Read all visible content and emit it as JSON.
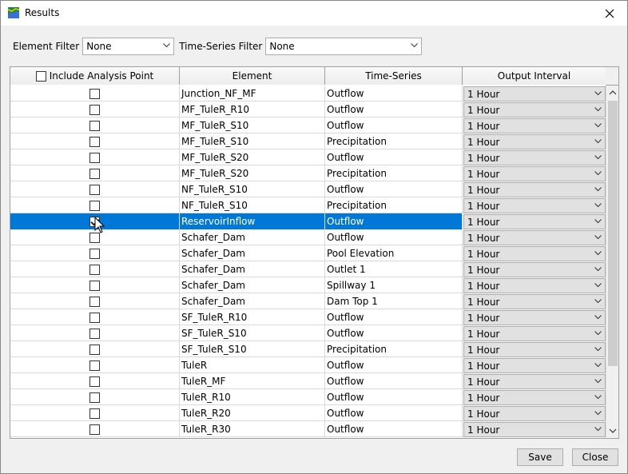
{
  "window": {
    "title": "Results"
  },
  "filters": {
    "element_label": "Element Filter",
    "element_value": "None",
    "timeseries_label": "Time-Series Filter",
    "timeseries_value": "None"
  },
  "table": {
    "headers": {
      "include": "Include Analysis Point",
      "element": "Element",
      "timeseries": "Time-Series",
      "interval": "Output Interval"
    },
    "rows": [
      {
        "checked": false,
        "element": "Junction_NF_MF",
        "timeseries": "Outflow",
        "interval": "1 Hour"
      },
      {
        "checked": false,
        "element": "MF_TuleR_R10",
        "timeseries": "Outflow",
        "interval": "1 Hour"
      },
      {
        "checked": false,
        "element": "MF_TuleR_S10",
        "timeseries": "Outflow",
        "interval": "1 Hour"
      },
      {
        "checked": false,
        "element": "MF_TuleR_S10",
        "timeseries": "Precipitation",
        "interval": "1 Hour"
      },
      {
        "checked": false,
        "element": "MF_TuleR_S20",
        "timeseries": "Outflow",
        "interval": "1 Hour"
      },
      {
        "checked": false,
        "element": "MF_TuleR_S20",
        "timeseries": "Precipitation",
        "interval": "1 Hour"
      },
      {
        "checked": false,
        "element": "NF_TuleR_S10",
        "timeseries": "Outflow",
        "interval": "1 Hour"
      },
      {
        "checked": false,
        "element": "NF_TuleR_S10",
        "timeseries": "Precipitation",
        "interval": "1 Hour"
      },
      {
        "checked": true,
        "selected": true,
        "element": "ReservoirInflow",
        "timeseries": "Outflow",
        "interval": "1 Hour"
      },
      {
        "checked": false,
        "element": "Schafer_Dam",
        "timeseries": "Outflow",
        "interval": "1 Hour"
      },
      {
        "checked": false,
        "element": "Schafer_Dam",
        "timeseries": "Pool Elevation",
        "interval": "1 Hour"
      },
      {
        "checked": false,
        "element": "Schafer_Dam",
        "timeseries": "Outlet 1",
        "interval": "1 Hour"
      },
      {
        "checked": false,
        "element": "Schafer_Dam",
        "timeseries": "Spillway 1",
        "interval": "1 Hour"
      },
      {
        "checked": false,
        "element": "Schafer_Dam",
        "timeseries": "Dam Top 1",
        "interval": "1 Hour"
      },
      {
        "checked": false,
        "element": "SF_TuleR_R10",
        "timeseries": "Outflow",
        "interval": "1 Hour"
      },
      {
        "checked": false,
        "element": "SF_TuleR_S10",
        "timeseries": "Outflow",
        "interval": "1 Hour"
      },
      {
        "checked": false,
        "element": "SF_TuleR_S10",
        "timeseries": "Precipitation",
        "interval": "1 Hour"
      },
      {
        "checked": false,
        "element": "TuleR",
        "timeseries": "Outflow",
        "interval": "1 Hour"
      },
      {
        "checked": false,
        "element": "TuleR_MF",
        "timeseries": "Outflow",
        "interval": "1 Hour"
      },
      {
        "checked": false,
        "element": "TuleR_R10",
        "timeseries": "Outflow",
        "interval": "1 Hour"
      },
      {
        "checked": false,
        "element": "TuleR_R20",
        "timeseries": "Outflow",
        "interval": "1 Hour"
      },
      {
        "checked": false,
        "element": "TuleR_R30",
        "timeseries": "Outflow",
        "interval": "1 Hour"
      }
    ]
  },
  "buttons": {
    "save": "Save",
    "close": "Close"
  },
  "icons": {
    "app": "hms-results-icon",
    "close": "close-icon",
    "dropdown": "chevron-down-icon"
  },
  "colors": {
    "selection": "#0078d7"
  }
}
